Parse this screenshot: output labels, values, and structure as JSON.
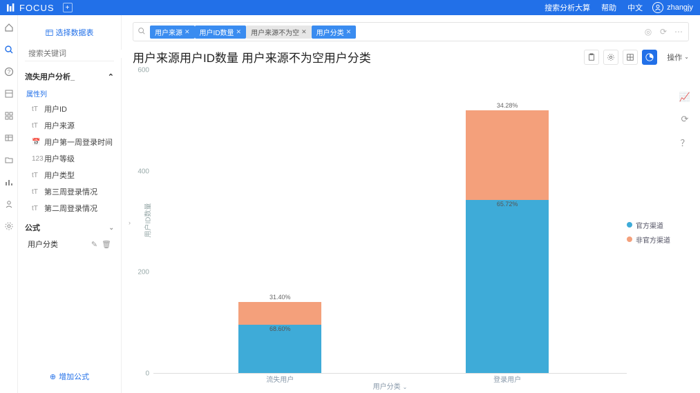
{
  "app": {
    "name": "FOCUS"
  },
  "topbar": {
    "links": [
      "搜索分析大算",
      "帮助",
      "中文"
    ],
    "user": "zhangjy"
  },
  "nav_icons": [
    "home",
    "search",
    "help",
    "board",
    "grid",
    "table",
    "folder",
    "chart",
    "user",
    "gear"
  ],
  "side": {
    "select_btn": "选择数据表",
    "search_placeholder": "搜索关键词",
    "section": "流失用户分析_",
    "sub_label": "属性列",
    "attrs": [
      {
        "icon": "tT",
        "label": "用户ID"
      },
      {
        "icon": "tT",
        "label": "用户来源"
      },
      {
        "icon": "📅",
        "label": "用户第一周登录时间"
      },
      {
        "icon": "123",
        "label": "用户等级"
      },
      {
        "icon": "tT",
        "label": "用户类型"
      },
      {
        "icon": "tT",
        "label": "第三周登录情况"
      },
      {
        "icon": "tT",
        "label": "第二周登录情况"
      }
    ],
    "formula_hd": "公式",
    "formula_item": "用户分类",
    "add_formula": "增加公式"
  },
  "query": {
    "chips": [
      {
        "text": "用户来源",
        "style": "blue"
      },
      {
        "text": "用户ID数量",
        "style": "blue"
      },
      {
        "text": "用户来源不为空",
        "style": "gray"
      },
      {
        "text": "用户分类",
        "style": "blue"
      }
    ]
  },
  "title": "用户来源用户ID数量 用户来源不为空用户分类",
  "operate": "操作",
  "legend": [
    "官方渠道",
    "非官方渠道"
  ],
  "right_tools": [
    "edit",
    "refresh",
    "help"
  ],
  "chart_data": {
    "type": "bar",
    "stacked": true,
    "xlabel": "用户分类",
    "ylabel": "用户ID数量",
    "ylim": [
      0,
      600
    ],
    "yticks": [
      0,
      200,
      400,
      600
    ],
    "categories": [
      "流失用户",
      "登录用户"
    ],
    "series": [
      {
        "name": "官方渠道",
        "values": [
          96,
          342
        ],
        "pct": [
          "68.60%",
          "65.72%"
        ],
        "color": "#3eabd8"
      },
      {
        "name": "非官方渠道",
        "values": [
          44,
          178
        ],
        "pct": [
          "31.40%",
          "34.28%"
        ],
        "color": "#f4a07b"
      }
    ]
  }
}
